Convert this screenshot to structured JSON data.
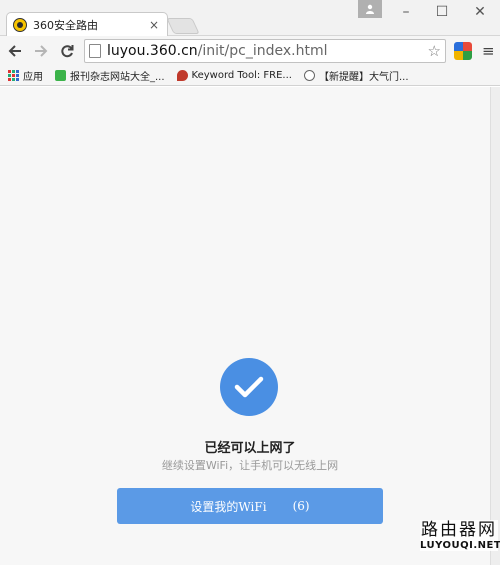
{
  "browser": {
    "tab_title": "360安全路由",
    "tab_close": "×",
    "url_host": "luyou.360.cn",
    "url_path": "/init/pc_index.html",
    "bookmarks": [
      {
        "label": "应用"
      },
      {
        "label": "报刊杂志网站大全_..."
      },
      {
        "label": "Keyword Tool: FRE..."
      },
      {
        "label": "【新提醒】大气门..."
      }
    ],
    "window_controls": {
      "minimize": "–",
      "maximize": "☐",
      "close": "✕"
    }
  },
  "page": {
    "headline": "已经可以上网了",
    "subline": "继续设置WiFi，让手机可以无线上网",
    "button_label": "设置我的WiFi",
    "button_count": "(6)"
  },
  "watermark": {
    "chinese": "路由器网",
    "english": "LUYOUQI.NET"
  },
  "colors": {
    "accent": "#4a8fe3",
    "button": "#5b9ae6",
    "page_bg": "#f7f7f7"
  },
  "icons": [
    "back-arrow-icon",
    "forward-arrow-icon",
    "reload-icon",
    "star-icon",
    "menu-icon",
    "check-icon",
    "user-icon"
  ]
}
